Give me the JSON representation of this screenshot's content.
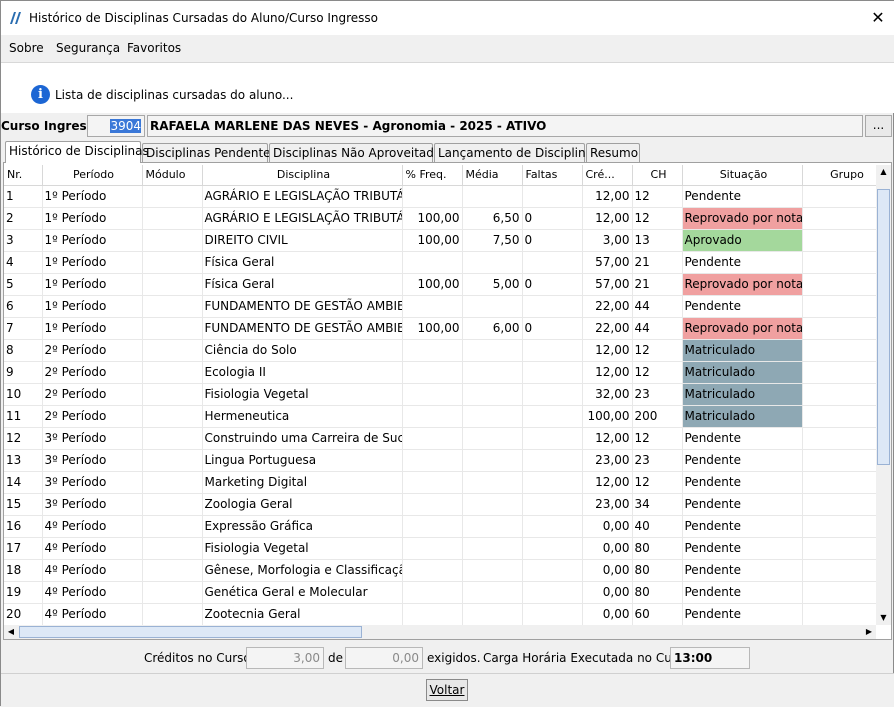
{
  "window": {
    "title": "Histórico de Disciplinas Cursadas do Aluno/Curso Ingresso",
    "close": "✕"
  },
  "menu": [
    "Sobre",
    "Segurança",
    "Favoritos"
  ],
  "info": {
    "text": "Lista de disciplinas cursadas do aluno..."
  },
  "curso": {
    "label": "Curso Ingresso:",
    "code": "3904",
    "name": "RAFAELA MARLENE DAS NEVES - Agronomia - 2025 - ATIVO",
    "button": "..."
  },
  "tabs": [
    "Histórico de Disciplinas",
    "Disciplinas Pendentes",
    "Disciplinas Não Aproveitadas",
    "Lançamento de Disciplinas",
    "Resumo"
  ],
  "grid": {
    "columns": [
      "Nr.",
      "Período",
      "Módulo",
      "Disciplina",
      "% Freq.",
      "Média",
      "Faltas",
      "Cré...",
      "CH",
      "Situação",
      "Grupo"
    ],
    "rows": [
      [
        "1",
        "1º Período",
        "",
        "AGRÁRIO E LEGISLAÇÃO TRIBUTÁRIA",
        "",
        "",
        "",
        "12,00",
        "12",
        "Pendente",
        ""
      ],
      [
        "2",
        "1º Período",
        "",
        "AGRÁRIO E LEGISLAÇÃO TRIBUTÁRIA",
        "100,00",
        "6,50",
        "0",
        "12,00",
        "12",
        "Reprovado por nota",
        ""
      ],
      [
        "3",
        "1º Período",
        "",
        "DIREITO CIVIL",
        "100,00",
        "7,50",
        "0",
        "3,00",
        "13",
        "Aprovado",
        ""
      ],
      [
        "4",
        "1º Período",
        "",
        "Física Geral",
        "",
        "",
        "",
        "57,00",
        "21",
        "Pendente",
        ""
      ],
      [
        "5",
        "1º Período",
        "",
        "Física Geral",
        "100,00",
        "5,00",
        "0",
        "57,00",
        "21",
        "Reprovado por nota",
        ""
      ],
      [
        "6",
        "1º Período",
        "",
        "FUNDAMENTO DE GESTÃO AMBIE...",
        "",
        "",
        "",
        "22,00",
        "44",
        "Pendente",
        ""
      ],
      [
        "7",
        "1º Período",
        "",
        "FUNDAMENTO DE GESTÃO AMBIE...",
        "100,00",
        "6,00",
        "0",
        "22,00",
        "44",
        "Reprovado por nota",
        ""
      ],
      [
        "8",
        "2º Período",
        "",
        "Ciência do Solo",
        "",
        "",
        "",
        "12,00",
        "12",
        "Matriculado",
        ""
      ],
      [
        "9",
        "2º Período",
        "",
        "Ecologia II",
        "",
        "",
        "",
        "12,00",
        "12",
        "Matriculado",
        ""
      ],
      [
        "10",
        "2º Período",
        "",
        "Fisiologia Vegetal",
        "",
        "",
        "",
        "32,00",
        "23",
        "Matriculado",
        ""
      ],
      [
        "11",
        "2º Período",
        "",
        "Hermeneutica",
        "",
        "",
        "",
        "100,00",
        "200",
        "Matriculado",
        ""
      ],
      [
        "12",
        "3º Período",
        "",
        "Construindo uma Carreira de Suces...",
        "",
        "",
        "",
        "12,00",
        "12",
        "Pendente",
        ""
      ],
      [
        "13",
        "3º Período",
        "",
        "Lingua Portuguesa",
        "",
        "",
        "",
        "23,00",
        "23",
        "Pendente",
        ""
      ],
      [
        "14",
        "3º Período",
        "",
        "Marketing Digital",
        "",
        "",
        "",
        "12,00",
        "12",
        "Pendente",
        ""
      ],
      [
        "15",
        "3º Período",
        "",
        "Zoologia Geral",
        "",
        "",
        "",
        "23,00",
        "34",
        "Pendente",
        ""
      ],
      [
        "16",
        "4º Período",
        "",
        "Expressão Gráfica",
        "",
        "",
        "",
        "0,00",
        "40",
        "Pendente",
        ""
      ],
      [
        "17",
        "4º Período",
        "",
        "Fisiologia Vegetal",
        "",
        "",
        "",
        "0,00",
        "80",
        "Pendente",
        ""
      ],
      [
        "18",
        "4º Período",
        "",
        "Gênese, Morfologia e Classificação ...",
        "",
        "",
        "",
        "0,00",
        "80",
        "Pendente",
        ""
      ],
      [
        "19",
        "4º Período",
        "",
        "Genética Geral e Molecular",
        "",
        "",
        "",
        "0,00",
        "80",
        "Pendente",
        ""
      ],
      [
        "20",
        "4º Período",
        "",
        "Zootecnia Geral",
        "",
        "",
        "",
        "0,00",
        "60",
        "Pendente",
        ""
      ]
    ],
    "status_colors": {
      "Reprovado por nota": "#f0a0a0",
      "Aprovado": "#a4d89c",
      "Matriculado": "#8ea8b4",
      "Pendente": "#ffffff"
    }
  },
  "footer": {
    "creditos_label": "Créditos no Curso:",
    "creditos_value": "3,00",
    "de_label": "de",
    "exigidos_value": "0,00",
    "exigidos_label": "exigidos.",
    "carga_label": "Carga Horária Executada no Curso:",
    "carga_value": "13:00"
  },
  "buttons": {
    "voltar": "Voltar"
  }
}
